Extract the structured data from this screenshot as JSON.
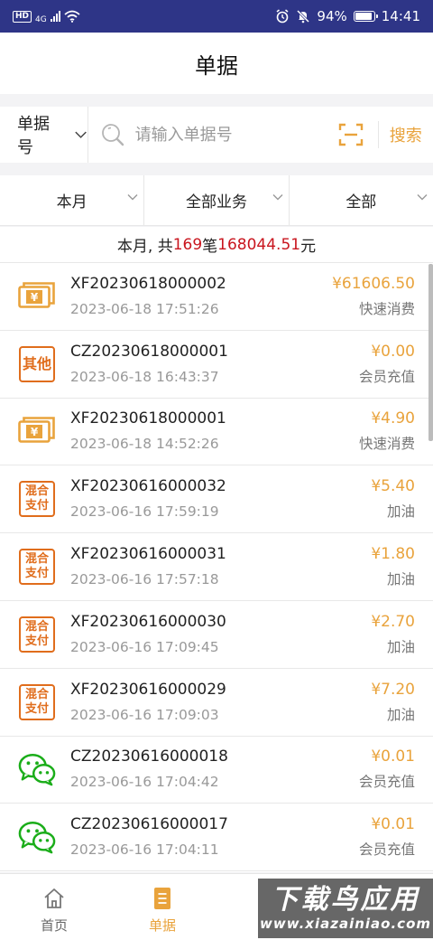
{
  "status_bar": {
    "badge": "HD",
    "network": "4G",
    "battery_pct": "94%",
    "battery_level": 0.94,
    "time": "14:41"
  },
  "header": {
    "title": "单据"
  },
  "search": {
    "type_label": "单据号",
    "placeholder": "请输入单据号",
    "button_label": "搜索"
  },
  "filters": {
    "period": "本月",
    "business": "全部业务",
    "status": "全部"
  },
  "summary": {
    "prefix": "本月, 共",
    "count": "169",
    "unit": "笔",
    "total": "168044.51",
    "suffix": "元"
  },
  "bills": [
    {
      "icon": "cash-icon",
      "icon_text": "¥",
      "number": "XF20230618000002",
      "time": "2023-06-18 17:51:26",
      "amount": "¥61606.50",
      "type": "快速消费"
    },
    {
      "icon": "other-icon",
      "icon_text": "其他",
      "number": "CZ20230618000001",
      "time": "2023-06-18 16:43:37",
      "amount": "¥0.00",
      "type": "会员充值"
    },
    {
      "icon": "cash-icon",
      "icon_text": "¥",
      "number": "XF20230618000001",
      "time": "2023-06-18 14:52:26",
      "amount": "¥4.90",
      "type": "快速消费"
    },
    {
      "icon": "mixed-pay-icon",
      "icon_text_1": "混合",
      "icon_text_2": "支付",
      "number": "XF20230616000032",
      "time": "2023-06-16 17:59:19",
      "amount": "¥5.40",
      "type": "加油"
    },
    {
      "icon": "mixed-pay-icon",
      "icon_text_1": "混合",
      "icon_text_2": "支付",
      "number": "XF20230616000031",
      "time": "2023-06-16 17:57:18",
      "amount": "¥1.80",
      "type": "加油"
    },
    {
      "icon": "mixed-pay-icon",
      "icon_text_1": "混合",
      "icon_text_2": "支付",
      "number": "XF20230616000030",
      "time": "2023-06-16 17:09:45",
      "amount": "¥2.70",
      "type": "加油"
    },
    {
      "icon": "mixed-pay-icon",
      "icon_text_1": "混合",
      "icon_text_2": "支付",
      "number": "XF20230616000029",
      "time": "2023-06-16 17:09:03",
      "amount": "¥7.20",
      "type": "加油"
    },
    {
      "icon": "wechat-icon",
      "number": "CZ20230616000018",
      "time": "2023-06-16 17:04:42",
      "amount": "¥0.01",
      "type": "会员充值"
    },
    {
      "icon": "wechat-icon",
      "number": "CZ20230616000017",
      "time": "2023-06-16 17:04:11",
      "amount": "¥0.01",
      "type": "会员充值"
    }
  ],
  "tabs": {
    "home": "首页",
    "bills": "单据"
  },
  "watermark": {
    "title": "下载鸟应用",
    "url": "www.xiazainiao.com"
  },
  "colors": {
    "accent": "#e9a33c",
    "status_bar": "#2e3587",
    "icon_orange": "#e06d1c",
    "summary_red": "#c9151e",
    "wechat_green": "#1aad19"
  }
}
